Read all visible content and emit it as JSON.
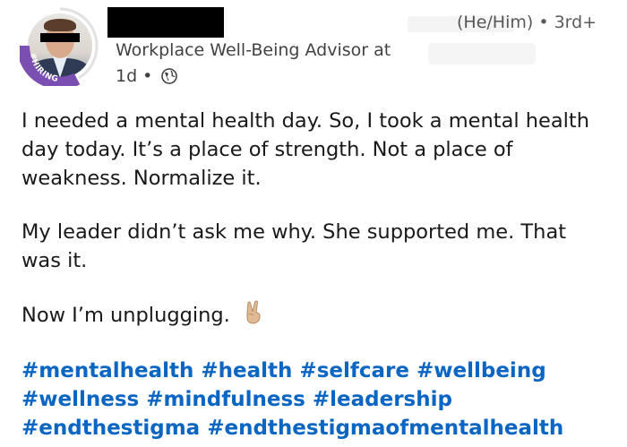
{
  "author": {
    "pronouns": "(He/Him) • 3rd+",
    "headline": "Workplace Well-Being Advisor at",
    "time": "1d",
    "visibility_icon": "globe-icon",
    "badge": "#HIRING",
    "badge_color": "#7b4fb2"
  },
  "post": {
    "paragraphs": [
      "I needed a mental health day. So, I took a mental health day today. It’s a place of strength. Not a place of weakness. Normalize it.",
      "My leader didn’t ask me why. She supported me. That was it."
    ],
    "closing": "Now I’m unplugging.",
    "closing_emoji": "victory-hand-emoji",
    "hashtags": [
      "#mentalhealth",
      "#health",
      "#selfcare",
      "#wellbeing",
      "#wellness",
      "#mindfulness",
      "#leadership",
      "#endthestigma",
      "#endthestigmaofmentalhealth"
    ],
    "hashtag_color": "#0a66c2"
  }
}
